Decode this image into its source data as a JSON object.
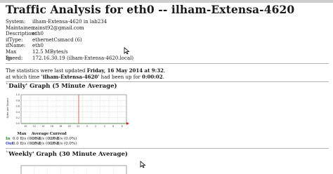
{
  "page": {
    "title": "Traffic Analysis for eth0 -- ilham-Extensa-4620"
  },
  "system_info": [
    {
      "label": "System:",
      "value": "ilham-Extensa-4620 in lab234"
    },
    {
      "label": "Maintainer:",
      "value": "zainst92@gmail.com"
    },
    {
      "label": "Description:",
      "value": "eth0"
    },
    {
      "label": "ifType:",
      "value": "ethernetCsmacd (6)"
    },
    {
      "label": "ifName:",
      "value": "eth0"
    },
    {
      "label": "Max Speed:",
      "value": "12.5 MBytes/s"
    },
    {
      "label": "Ip:",
      "value": "172.16.30.19 (ilham-Extensa-4620.local)"
    }
  ],
  "stats": {
    "line1_prefix": "The statistics were last updated ",
    "line1_date": "Friday, 16 May 2014 at 9:32",
    "line1_suffix": ",",
    "line2_prefix": "at which time ",
    "line2_host": "'ilham-Extensa-4620'",
    "line2_mid": " had been up for ",
    "line2_uptime": "0:00:02",
    "line2_suffix": "."
  },
  "daily_graph": {
    "title": "`Daily' Graph (5 Minute Average)",
    "y_axis_label": "Bytes per Second",
    "y_ticks": [
      "1.0",
      "0.8",
      "0.6",
      "0.4",
      "0.2",
      "0.0"
    ],
    "x_ticks": [
      "10",
      "12",
      "14",
      "16",
      "18",
      "20",
      "22",
      "0",
      "2",
      "4",
      "6",
      "8"
    ]
  },
  "legend": {
    "headers": [
      "Max",
      "Average",
      "Current"
    ],
    "in_key": "In",
    "out_key": "Out",
    "in_values": [
      "0.0 B/s (0.0%)",
      "0.0 B/s (0.0%)",
      "0.0 B/s (0.0%)"
    ],
    "out_values": [
      "0.0 B/s (0.0%)",
      "0.0 B/s (0.0%)",
      "0.0 B/s (0.0%)"
    ]
  },
  "weekly_graph": {
    "title": "`Weekly' Graph (30 Minute Average)"
  },
  "colors": {
    "in": "#2c8a2c",
    "out": "#2b3fd0",
    "now_line": "#d22020",
    "grid": "#c8c8c8"
  }
}
